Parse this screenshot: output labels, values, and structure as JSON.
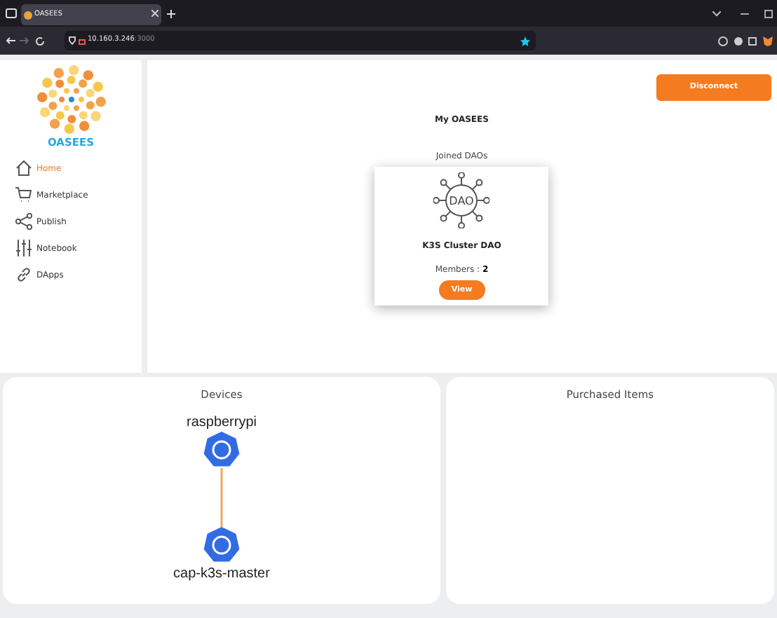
{
  "browser": {
    "tab_title": "OASEES",
    "url_host": "10.160.3.246",
    "url_port": ":3000"
  },
  "sidebar": {
    "logo_text": "OASEES",
    "items": [
      {
        "label": "Home",
        "selected": true
      },
      {
        "label": "Marketplace",
        "selected": false
      },
      {
        "label": "Publish",
        "selected": false
      },
      {
        "label": "Notebook",
        "selected": false
      },
      {
        "label": "DApps",
        "selected": false
      }
    ]
  },
  "header": {
    "disconnect_button": "Disconnect",
    "title": "My OASEES",
    "subtitle": "Joined DAOs"
  },
  "daos": [
    {
      "icon_text": "DAO",
      "name": "K3S Cluster DAO",
      "members_label": "Members : ",
      "members": "2",
      "button": "View"
    }
  ],
  "devices": {
    "title": "Devices",
    "nodes": [
      {
        "name": "raspberrypi"
      },
      {
        "name": "cap-k3s-master"
      }
    ]
  },
  "purchased": {
    "title": "Purchased Items"
  }
}
